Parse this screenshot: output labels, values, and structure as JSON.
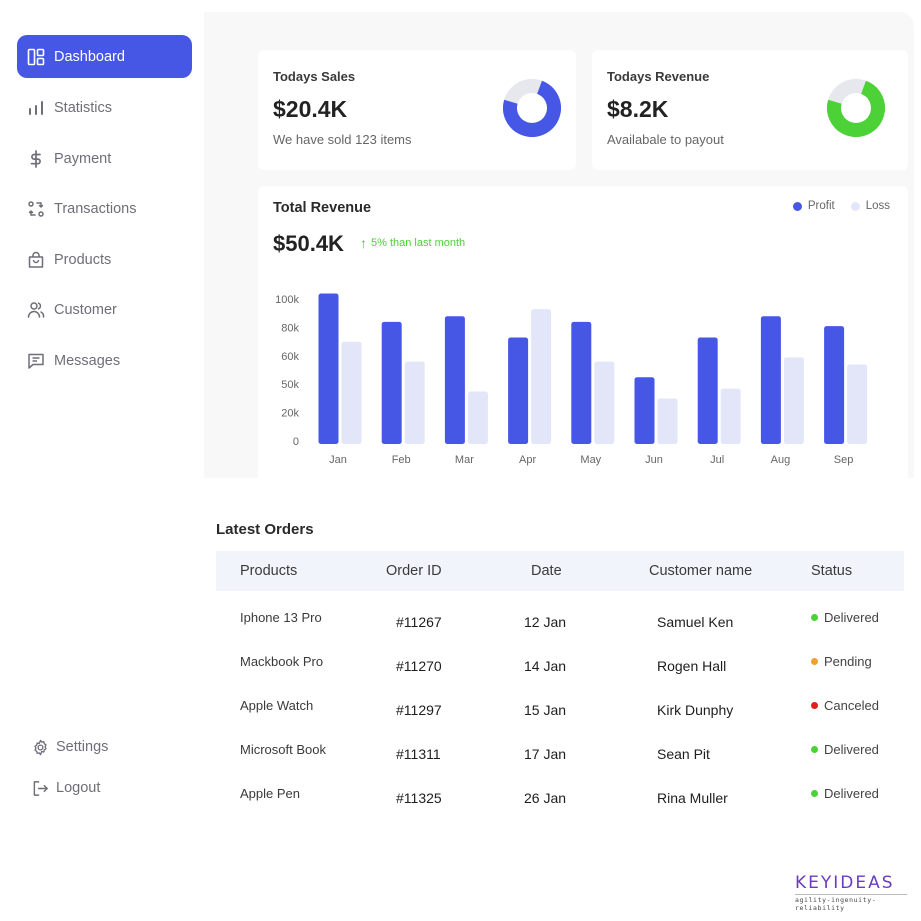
{
  "sidebar": {
    "items": [
      {
        "label": "Dashboard",
        "icon": "dashboard-icon",
        "active": true
      },
      {
        "label": "Statistics",
        "icon": "bar-chart-icon",
        "active": false
      },
      {
        "label": "Payment",
        "icon": "dollar-icon",
        "active": false
      },
      {
        "label": "Transactions",
        "icon": "transactions-icon",
        "active": false
      },
      {
        "label": "Products",
        "icon": "shopping-bag-icon",
        "active": false
      },
      {
        "label": "Customer",
        "icon": "users-icon",
        "active": false
      },
      {
        "label": "Messages",
        "icon": "message-icon",
        "active": false
      }
    ],
    "bottom": [
      {
        "label": "Settings",
        "icon": "gear-icon"
      },
      {
        "label": "Logout",
        "icon": "logout-icon"
      }
    ],
    "active_color": "#4657e5"
  },
  "cards": {
    "sales": {
      "title": "Todays Sales",
      "value": "$20.4K",
      "subtitle": "We have sold 123 items",
      "progress": 0.74,
      "color": "#4657e5",
      "track_color": "#e6e8ee"
    },
    "revenue": {
      "title": "Todays Revenue",
      "value": "$8.2K",
      "subtitle": "Availabale to payout",
      "progress": 0.74,
      "color": "#4cd137",
      "track_color": "#e6e8ee"
    }
  },
  "total_revenue": {
    "title": "Total Revenue",
    "value": "$50.4K",
    "delta_arrow": "↑",
    "delta_text": "5% than last month",
    "delta_color": "#4cd137"
  },
  "chart_data": {
    "type": "bar",
    "title": "Total Revenue",
    "categories": [
      "Jan",
      "Feb",
      "Mar",
      "Apr",
      "May",
      "Jun",
      "Jul",
      "Aug",
      "Sep"
    ],
    "series": [
      {
        "name": "Profit",
        "color": "#4657e5",
        "values": [
          106,
          86,
          90,
          75,
          86,
          47,
          75,
          90,
          83
        ]
      },
      {
        "name": "Loss",
        "color": "#e3e6f8",
        "values": [
          72,
          58,
          37,
          95,
          58,
          32,
          39,
          61,
          56
        ]
      }
    ],
    "yticks": [
      "0",
      "20k",
      "50k",
      "60k",
      "80k",
      "100k"
    ],
    "ylim": [
      0,
      100
    ],
    "value_units": "thousands (tick-position scale)",
    "xlabel": "",
    "ylabel": "",
    "grid": false,
    "legend": "top-right"
  },
  "orders": {
    "title": "Latest Orders",
    "columns": [
      "Products",
      "Order ID",
      "Date",
      "Customer name",
      "Status"
    ],
    "rows": [
      {
        "product": "Iphone 13 Pro",
        "id": "#11267",
        "date": "12 Jan",
        "customer": "Samuel  Ken",
        "status": "Delivered",
        "status_color": "#4cd137"
      },
      {
        "product": "Mackbook Pro",
        "id": "#11270",
        "date": "14 Jan",
        "customer": "Rogen Hall",
        "status": "Pending",
        "status_color": "#f0a030"
      },
      {
        "product": "Apple Watch",
        "id": "#11297",
        "date": "15 Jan",
        "customer": "Kirk Dunphy",
        "status": "Canceled",
        "status_color": "#e01e1e"
      },
      {
        "product": "Microsoft Book",
        "id": "#11311",
        "date": "17 Jan",
        "customer": "Sean Pit",
        "status": "Delivered",
        "status_color": "#4cd137"
      },
      {
        "product": "Apple Pen",
        "id": "#11325",
        "date": "26 Jan",
        "customer": "Rina Muller",
        "status": "Delivered",
        "status_color": "#4cd137"
      }
    ]
  },
  "brand": {
    "name": "KEYIDEAS",
    "tagline": "agility-ingenuity-reliability"
  }
}
